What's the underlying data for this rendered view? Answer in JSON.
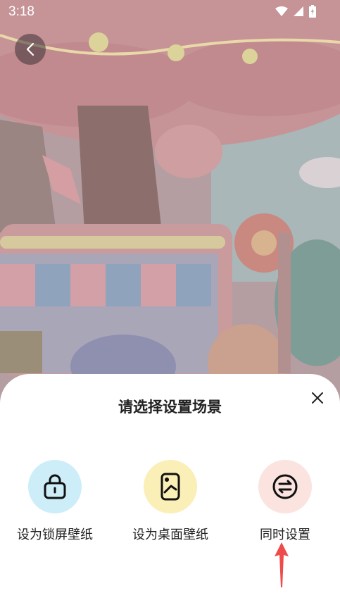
{
  "status": {
    "time": "3:18",
    "wifi_icon": "wifi-icon",
    "signal_icon": "signal-icon",
    "battery_icon": "battery-icon"
  },
  "header": {
    "back_icon": "chevron-left-icon"
  },
  "sheet": {
    "title": "请选择设置场景",
    "close_icon": "close-icon",
    "options": [
      {
        "label": "设为锁屏壁纸",
        "icon": "lock-icon",
        "color": "#cdeef9"
      },
      {
        "label": "设为桌面壁纸",
        "icon": "phone-icon",
        "color": "#fbefb8"
      },
      {
        "label": "同时设置",
        "icon": "swap-icon",
        "color": "#fbe3e0"
      }
    ]
  },
  "colors": {
    "arrow": "#ef4b4b"
  }
}
